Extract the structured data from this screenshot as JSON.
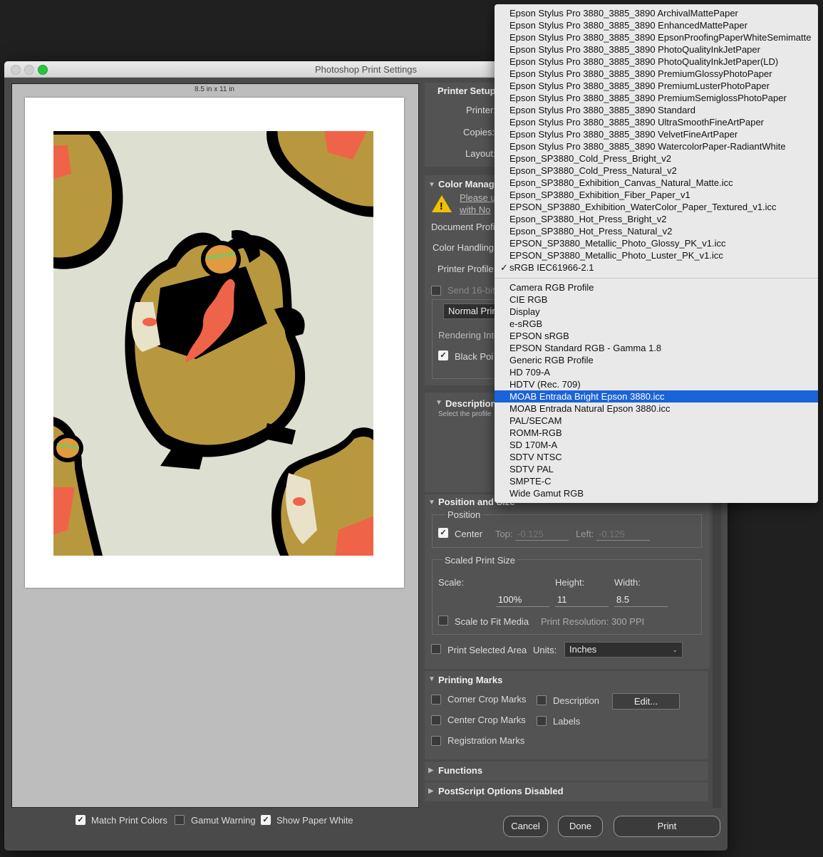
{
  "window": {
    "title": "Photoshop Print Settings"
  },
  "preview": {
    "paper_size": "8.5 in x 11 in"
  },
  "printer_setup": {
    "heading": "Printer Setup",
    "printer_label": "Printer:",
    "copies_label": "Copies:",
    "layout_label": "Layout:"
  },
  "color_management": {
    "heading": "Color Manag",
    "warning_line1": "Please u",
    "warning_line2": "with No",
    "document_profile_label": "Document Profi",
    "color_handling_label": "Color Handling:",
    "printer_profile_label": "Printer Profile:",
    "send16_label": "Send 16-bit",
    "normal_printing": "Normal Prin",
    "rendering_intent_label": "Rendering Inte",
    "black_point_label": "Black Poi"
  },
  "description": {
    "heading": "Description",
    "text": "Select the profile"
  },
  "position_size": {
    "heading": "Position and Size",
    "position_label": "Position",
    "center_label": "Center",
    "top_label": "Top:",
    "top_value": "-0.125",
    "left_label": "Left:",
    "left_value": "-0.125",
    "scaled_label": "Scaled Print Size",
    "scale_label": "Scale:",
    "scale_value": "100%",
    "height_label": "Height:",
    "height_value": "11",
    "width_label": "Width:",
    "width_value": "8.5",
    "scale_fit_label": "Scale to Fit Media",
    "resolution_text": "Print Resolution: 300 PPI",
    "print_selected_label": "Print Selected Area",
    "units_label": "Units:",
    "units_value": "Inches"
  },
  "printing_marks": {
    "heading": "Printing Marks",
    "corner_crop": "Corner Crop Marks",
    "center_crop": "Center Crop Marks",
    "registration": "Registration Marks",
    "description": "Description",
    "labels": "Labels",
    "edit_button": "Edit..."
  },
  "functions": {
    "heading": "Functions"
  },
  "postscript": {
    "heading": "PostScript Options Disabled"
  },
  "bottom": {
    "match_print_colors": "Match Print Colors",
    "gamut_warning": "Gamut Warning",
    "show_paper_white": "Show Paper White",
    "cancel": "Cancel",
    "done": "Done",
    "print": "Print"
  },
  "menu": {
    "group1": [
      "Epson Stylus Pro 3880_3885_3890 ArchivalMattePaper",
      "Epson Stylus Pro 3880_3885_3890 EnhancedMattePaper",
      "Epson Stylus Pro 3880_3885_3890 EpsonProofingPaperWhiteSemimatte",
      "Epson Stylus Pro 3880_3885_3890 PhotoQualityInkJetPaper",
      "Epson Stylus Pro 3880_3885_3890 PhotoQualityInkJetPaper(LD)",
      "Epson Stylus Pro 3880_3885_3890 PremiumGlossyPhotoPaper",
      "Epson Stylus Pro 3880_3885_3890 PremiumLusterPhotoPaper",
      "Epson Stylus Pro 3880_3885_3890 PremiumSemiglossPhotoPaper",
      "Epson Stylus Pro 3880_3885_3890 Standard",
      "Epson Stylus Pro 3880_3885_3890 UltraSmoothFineArtPaper",
      "Epson Stylus Pro 3880_3885_3890 VelvetFineArtPaper",
      "Epson Stylus Pro 3880_3885_3890 WatercolorPaper-RadiantWhite",
      "Epson_SP3880_Cold_Press_Bright_v2",
      "Epson_SP3880_Cold_Press_Natural_v2",
      "Epson_SP3880_Exhibition_Canvas_Natural_Matte.icc",
      "Epson_SP3880_Exhibition_Fiber_Paper_v1",
      "EPSON_SP3880_Exhibition_WaterColor_Paper_Textured_v1.icc",
      "Epson_SP3880_Hot_Press_Bright_v2",
      "Epson_SP3880_Hot_Press_Natural_v2",
      "EPSON_SP3880_Metallic_Photo_Glossy_PK_v1.icc",
      "EPSON_SP3880_Metallic_Photo_Luster_PK_v1.icc",
      "sRGB IEC61966-2.1"
    ],
    "checked_item": "sRGB IEC61966-2.1",
    "checkmark": "✓",
    "group2": [
      "Camera RGB Profile",
      "CIE RGB",
      "Display",
      "e-sRGB",
      "EPSON  sRGB",
      "EPSON  Standard RGB - Gamma 1.8",
      "Generic RGB Profile",
      "HD 709-A",
      "HDTV (Rec. 709)",
      "MOAB Entrada Bright Epson 3880.icc",
      "MOAB Entrada Natural Epson 3880.icc",
      "PAL/SECAM",
      "ROMM-RGB",
      "SD 170M-A",
      "SDTV NTSC",
      "SDTV PAL",
      "SMPTE-C",
      "Wide Gamut RGB"
    ],
    "highlighted_item": "MOAB Entrada Bright Epson 3880.icc"
  },
  "colors": {
    "highlight": "#1b63d8",
    "dialog_bg": "#4a4a4a",
    "art_bg": "#dde0d0",
    "art_mustard": "#b8983f",
    "art_red": "#ef6448"
  }
}
